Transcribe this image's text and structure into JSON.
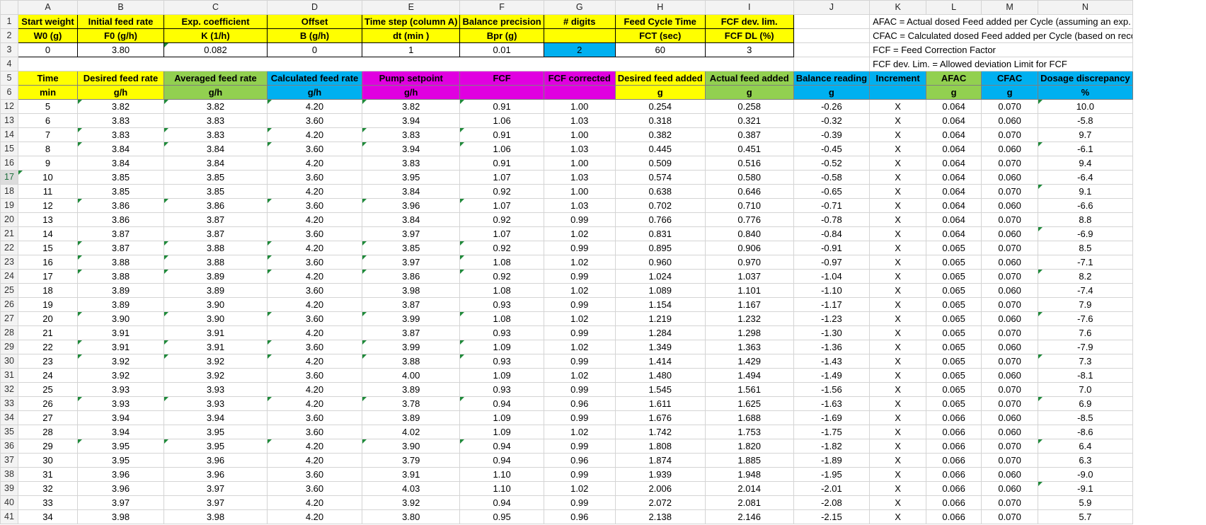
{
  "columns": [
    "A",
    "B",
    "C",
    "D",
    "E",
    "F",
    "G",
    "H",
    "I",
    "J",
    "K",
    "L",
    "M",
    "N"
  ],
  "param_headers": {
    "line1": [
      "Start weight",
      "Initial feed rate",
      "Exp. coefficient",
      "Offset",
      "Time step (column A)",
      "Balance precision",
      "# digits",
      "Feed Cycle Time",
      "FCF dev. lim."
    ],
    "line2": [
      "W0 (g)",
      "F0 (g/h)",
      "K (1/h)",
      "B (g/h)",
      "dt (min )",
      "Bpr (g)",
      "",
      "FCT (sec)",
      "FCF DL (%)"
    ],
    "values": [
      "0",
      "3.80",
      "0.082",
      "0",
      "1",
      "0.01",
      "2",
      "60",
      "3"
    ]
  },
  "notes": [
    "AFAC = Actual dosed Feed added per Cycle (assuming an exp. Feed",
    "CFAC = Calculated dosed Feed added per Cycle (based on recorded",
    "FCF = Feed Correction Factor",
    "FCF dev. Lim. = Allowed deviation Limit for FCF"
  ],
  "table_headers": {
    "names": [
      "Time",
      "Desired feed rate",
      "Averaged feed rate",
      "Calculated feed rate",
      "Pump setpoint",
      "FCF",
      "FCF corrected",
      "Desired feed added",
      "Actual feed added",
      "Balance reading",
      "Increment",
      "AFAC",
      "CFAC",
      "Dosage discrepancy"
    ],
    "units": [
      "min",
      "g/h",
      "g/h",
      "g/h",
      "g/h",
      "",
      "",
      "g",
      "g",
      "g",
      "",
      "g",
      "g",
      "%"
    ]
  },
  "row_numbers": [
    "1",
    "2",
    "3",
    "4",
    "5",
    "6",
    "12",
    "13",
    "14",
    "15",
    "16",
    "17",
    "18",
    "19",
    "20",
    "21",
    "22",
    "23",
    "24",
    "25",
    "26",
    "27",
    "28",
    "29",
    "30",
    "31",
    "32",
    "33",
    "34",
    "35",
    "36",
    "37",
    "38",
    "39",
    "40",
    "41"
  ],
  "rows": [
    [
      "5",
      "3.82",
      "3.82",
      "4.20",
      "3.82",
      "0.91",
      "1.00",
      "0.254",
      "0.258",
      "-0.26",
      "X",
      "0.064",
      "0.070",
      "10.0"
    ],
    [
      "6",
      "3.83",
      "3.83",
      "3.60",
      "3.94",
      "1.06",
      "1.03",
      "0.318",
      "0.321",
      "-0.32",
      "X",
      "0.064",
      "0.060",
      "-5.8"
    ],
    [
      "7",
      "3.83",
      "3.83",
      "4.20",
      "3.83",
      "0.91",
      "1.00",
      "0.382",
      "0.387",
      "-0.39",
      "X",
      "0.064",
      "0.070",
      "9.7"
    ],
    [
      "8",
      "3.84",
      "3.84",
      "3.60",
      "3.94",
      "1.06",
      "1.03",
      "0.445",
      "0.451",
      "-0.45",
      "X",
      "0.064",
      "0.060",
      "-6.1"
    ],
    [
      "9",
      "3.84",
      "3.84",
      "4.20",
      "3.83",
      "0.91",
      "1.00",
      "0.509",
      "0.516",
      "-0.52",
      "X",
      "0.064",
      "0.070",
      "9.4"
    ],
    [
      "10",
      "3.85",
      "3.85",
      "3.60",
      "3.95",
      "1.07",
      "1.03",
      "0.574",
      "0.580",
      "-0.58",
      "X",
      "0.064",
      "0.060",
      "-6.4"
    ],
    [
      "11",
      "3.85",
      "3.85",
      "4.20",
      "3.84",
      "0.92",
      "1.00",
      "0.638",
      "0.646",
      "-0.65",
      "X",
      "0.064",
      "0.070",
      "9.1"
    ],
    [
      "12",
      "3.86",
      "3.86",
      "3.60",
      "3.96",
      "1.07",
      "1.03",
      "0.702",
      "0.710",
      "-0.71",
      "X",
      "0.064",
      "0.060",
      "-6.6"
    ],
    [
      "13",
      "3.86",
      "3.87",
      "4.20",
      "3.84",
      "0.92",
      "0.99",
      "0.766",
      "0.776",
      "-0.78",
      "X",
      "0.064",
      "0.070",
      "8.8"
    ],
    [
      "14",
      "3.87",
      "3.87",
      "3.60",
      "3.97",
      "1.07",
      "1.02",
      "0.831",
      "0.840",
      "-0.84",
      "X",
      "0.064",
      "0.060",
      "-6.9"
    ],
    [
      "15",
      "3.87",
      "3.88",
      "4.20",
      "3.85",
      "0.92",
      "0.99",
      "0.895",
      "0.906",
      "-0.91",
      "X",
      "0.065",
      "0.070",
      "8.5"
    ],
    [
      "16",
      "3.88",
      "3.88",
      "3.60",
      "3.97",
      "1.08",
      "1.02",
      "0.960",
      "0.970",
      "-0.97",
      "X",
      "0.065",
      "0.060",
      "-7.1"
    ],
    [
      "17",
      "3.88",
      "3.89",
      "4.20",
      "3.86",
      "0.92",
      "0.99",
      "1.024",
      "1.037",
      "-1.04",
      "X",
      "0.065",
      "0.070",
      "8.2"
    ],
    [
      "18",
      "3.89",
      "3.89",
      "3.60",
      "3.98",
      "1.08",
      "1.02",
      "1.089",
      "1.101",
      "-1.10",
      "X",
      "0.065",
      "0.060",
      "-7.4"
    ],
    [
      "19",
      "3.89",
      "3.90",
      "4.20",
      "3.87",
      "0.93",
      "0.99",
      "1.154",
      "1.167",
      "-1.17",
      "X",
      "0.065",
      "0.070",
      "7.9"
    ],
    [
      "20",
      "3.90",
      "3.90",
      "3.60",
      "3.99",
      "1.08",
      "1.02",
      "1.219",
      "1.232",
      "-1.23",
      "X",
      "0.065",
      "0.060",
      "-7.6"
    ],
    [
      "21",
      "3.91",
      "3.91",
      "4.20",
      "3.87",
      "0.93",
      "0.99",
      "1.284",
      "1.298",
      "-1.30",
      "X",
      "0.065",
      "0.070",
      "7.6"
    ],
    [
      "22",
      "3.91",
      "3.91",
      "3.60",
      "3.99",
      "1.09",
      "1.02",
      "1.349",
      "1.363",
      "-1.36",
      "X",
      "0.065",
      "0.060",
      "-7.9"
    ],
    [
      "23",
      "3.92",
      "3.92",
      "4.20",
      "3.88",
      "0.93",
      "0.99",
      "1.414",
      "1.429",
      "-1.43",
      "X",
      "0.065",
      "0.070",
      "7.3"
    ],
    [
      "24",
      "3.92",
      "3.92",
      "3.60",
      "4.00",
      "1.09",
      "1.02",
      "1.480",
      "1.494",
      "-1.49",
      "X",
      "0.065",
      "0.060",
      "-8.1"
    ],
    [
      "25",
      "3.93",
      "3.93",
      "4.20",
      "3.89",
      "0.93",
      "0.99",
      "1.545",
      "1.561",
      "-1.56",
      "X",
      "0.065",
      "0.070",
      "7.0"
    ],
    [
      "26",
      "3.93",
      "3.93",
      "4.20",
      "3.78",
      "0.94",
      "0.96",
      "1.611",
      "1.625",
      "-1.63",
      "X",
      "0.065",
      "0.070",
      "6.9"
    ],
    [
      "27",
      "3.94",
      "3.94",
      "3.60",
      "3.89",
      "1.09",
      "0.99",
      "1.676",
      "1.688",
      "-1.69",
      "X",
      "0.066",
      "0.060",
      "-8.5"
    ],
    [
      "28",
      "3.94",
      "3.95",
      "3.60",
      "4.02",
      "1.09",
      "1.02",
      "1.742",
      "1.753",
      "-1.75",
      "X",
      "0.066",
      "0.060",
      "-8.6"
    ],
    [
      "29",
      "3.95",
      "3.95",
      "4.20",
      "3.90",
      "0.94",
      "0.99",
      "1.808",
      "1.820",
      "-1.82",
      "X",
      "0.066",
      "0.070",
      "6.4"
    ],
    [
      "30",
      "3.95",
      "3.96",
      "4.20",
      "3.79",
      "0.94",
      "0.96",
      "1.874",
      "1.885",
      "-1.89",
      "X",
      "0.066",
      "0.070",
      "6.3"
    ],
    [
      "31",
      "3.96",
      "3.96",
      "3.60",
      "3.91",
      "1.10",
      "0.99",
      "1.939",
      "1.948",
      "-1.95",
      "X",
      "0.066",
      "0.060",
      "-9.0"
    ],
    [
      "32",
      "3.96",
      "3.97",
      "3.60",
      "4.03",
      "1.10",
      "1.02",
      "2.006",
      "2.014",
      "-2.01",
      "X",
      "0.066",
      "0.060",
      "-9.1"
    ],
    [
      "33",
      "3.97",
      "3.97",
      "4.20",
      "3.92",
      "0.94",
      "0.99",
      "2.072",
      "2.081",
      "-2.08",
      "X",
      "0.066",
      "0.070",
      "5.9"
    ],
    [
      "34",
      "3.98",
      "3.98",
      "4.20",
      "3.80",
      "0.95",
      "0.96",
      "2.138",
      "2.146",
      "-2.15",
      "X",
      "0.066",
      "0.070",
      "5.7"
    ]
  ],
  "colors": {
    "param_header": "#ffff00",
    "green_header": "#92d050",
    "cyan_header": "#00b0f0",
    "magenta_header": "#e000e0",
    "digits_cell": "#00b0f0",
    "error_triangle": "#1f8a3a"
  }
}
